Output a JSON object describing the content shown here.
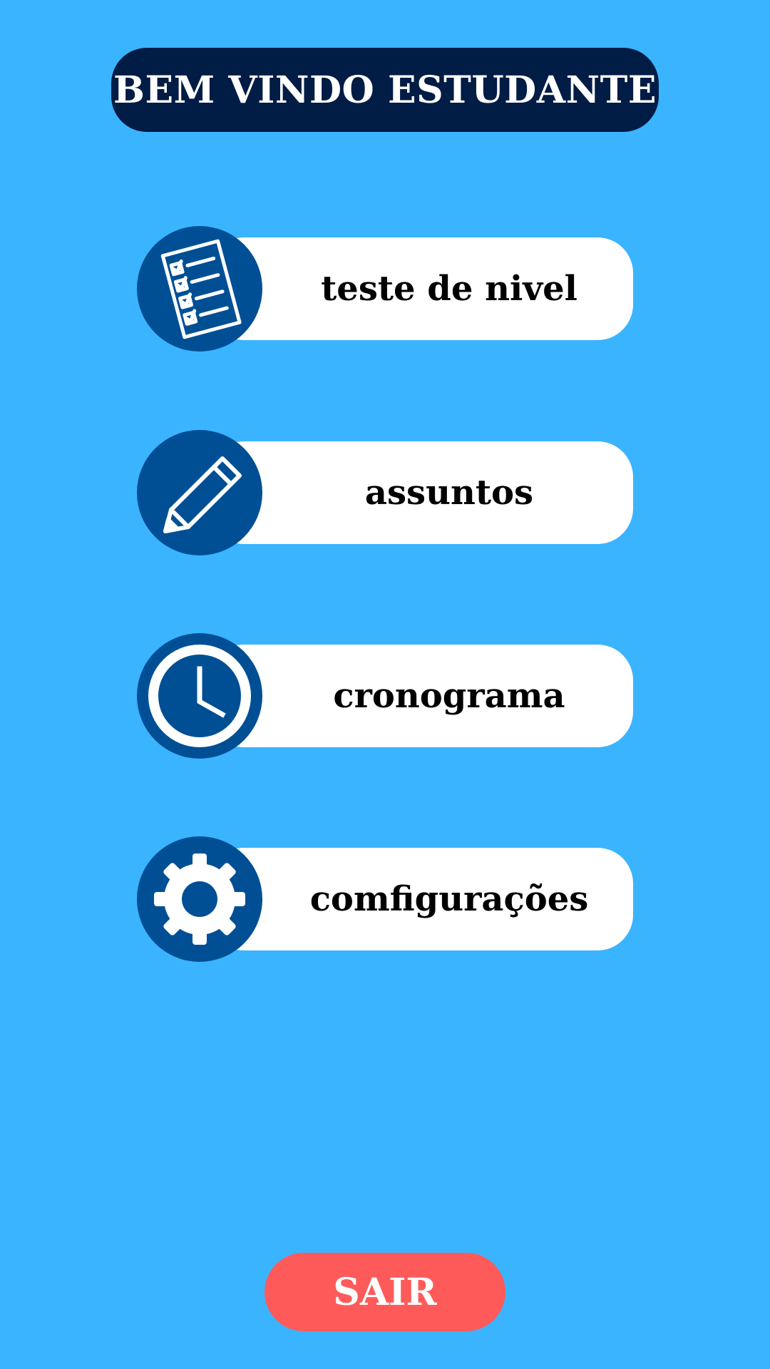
{
  "header": {
    "title": "BEM VINDO ESTUDANTE"
  },
  "menu": {
    "items": [
      {
        "label": "teste de nivel",
        "icon": "checklist-icon"
      },
      {
        "label": "assuntos",
        "icon": "pencil-icon"
      },
      {
        "label": "cronograma",
        "icon": "clock-icon"
      },
      {
        "label": "comfigurações",
        "icon": "gear-icon"
      }
    ]
  },
  "footer": {
    "exit_label": "SAIR"
  },
  "colors": {
    "background": "#3bb4ff",
    "header_bg": "#011c45",
    "icon_circle": "#004f95",
    "pill_bg": "#ffffff",
    "exit_button": "#ff5a5a"
  }
}
